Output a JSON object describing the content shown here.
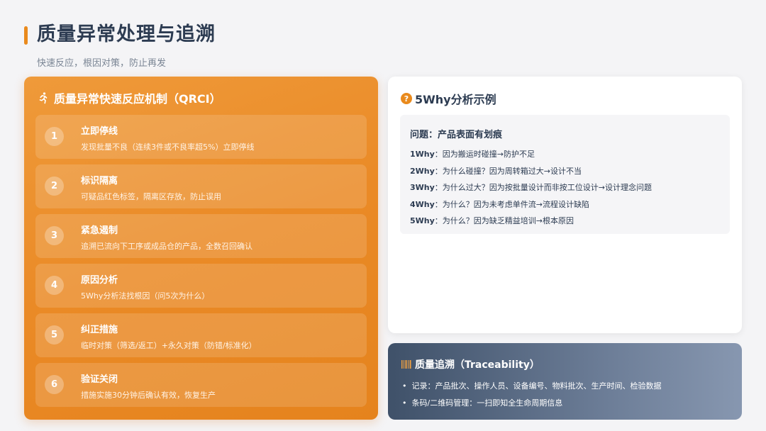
{
  "page": {
    "title": "质量异常处理与追溯",
    "subtitle": "快速反应，根因对策，防止再发"
  },
  "qrci": {
    "icon": "running-person-icon",
    "title": "质量异常快速反应机制（QRCI）",
    "steps": [
      {
        "num": "1",
        "title": "立即停线",
        "desc": "发现批量不良（连续3件或不良率超5%）立即停线"
      },
      {
        "num": "2",
        "title": "标识隔离",
        "desc": "可疑品红色标签，隔离区存放，防止误用"
      },
      {
        "num": "3",
        "title": "紧急遏制",
        "desc": "追溯已流向下工序或成品仓的产品，全数召回确认"
      },
      {
        "num": "4",
        "title": "原因分析",
        "desc": "5Why分析法找根因（问5次为什么）"
      },
      {
        "num": "5",
        "title": "纠正措施",
        "desc": "临时对策（筛选/返工）+永久对策（防错/标准化）"
      },
      {
        "num": "6",
        "title": "验证关闭",
        "desc": "措施实施30分钟后确认有效，恢复生产"
      }
    ]
  },
  "why": {
    "icon": "question-icon",
    "title": "5Why分析示例",
    "problem": "问题：产品表面有划痕",
    "lines": [
      {
        "label": "1Why",
        "text": "：因为搬运时碰撞→防护不足"
      },
      {
        "label": "2Why",
        "text": "：为什么碰撞？因为周转箱过大→设计不当"
      },
      {
        "label": "3Why",
        "text": "：为什么过大？因为按批量设计而非按工位设计→设计理念问题"
      },
      {
        "label": "4Why",
        "text": "：为什么？因为未考虑单件流→流程设计缺陷"
      },
      {
        "label": "5Why",
        "text": "：为什么？因为缺乏精益培训→根本原因"
      }
    ]
  },
  "trace": {
    "icon": "barcode-icon",
    "title": "质量追溯（Traceability）",
    "items": [
      "记录：产品批次、操作人员、设备编号、物料批次、生产时间、检验数据",
      "条码/二维码管理：一扫即知全生命周期信息"
    ],
    "bullet": "•"
  },
  "colors": {
    "accent": "#e98a1d",
    "title": "#2d3c52",
    "trace_start": "#3f5169",
    "trace_end": "#8797b0"
  }
}
